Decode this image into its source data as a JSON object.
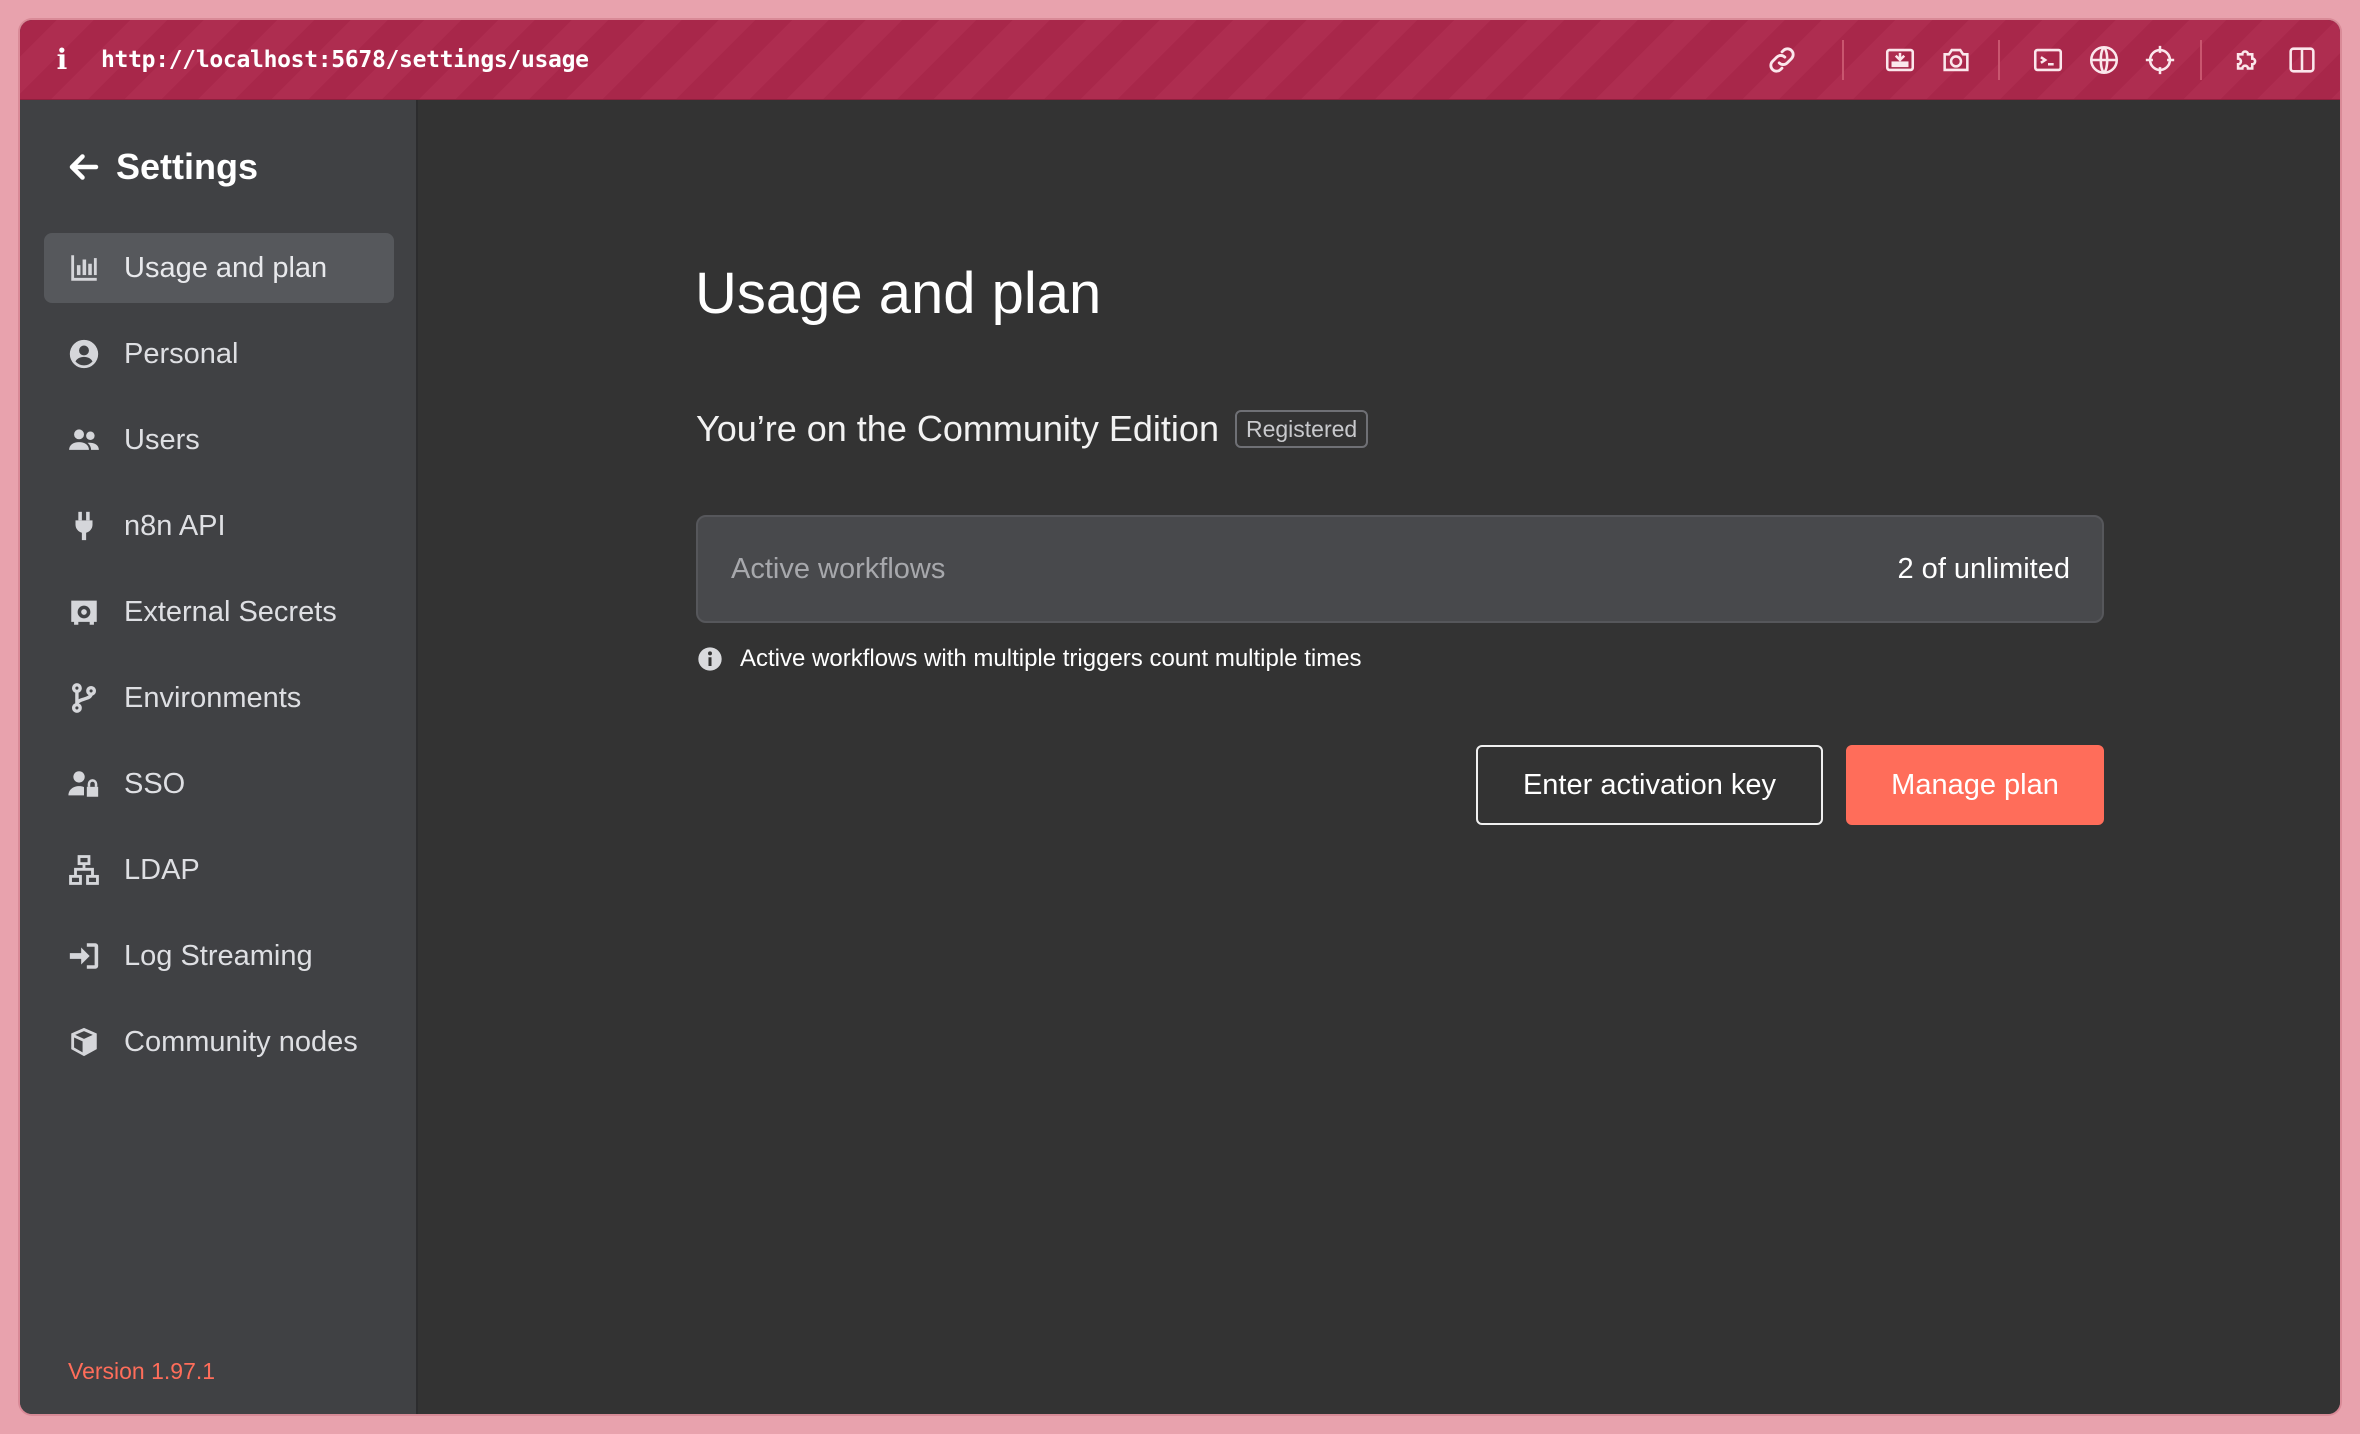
{
  "browser": {
    "url": "http://localhost:5678/settings/usage",
    "info_glyph": "i",
    "icons": [
      "link-icon",
      "screenshot-area-icon",
      "camera-icon",
      "terminal-icon",
      "globe-icon",
      "crosshair-icon",
      "extensions-icon",
      "sidebar-toggle-icon"
    ]
  },
  "sidebar": {
    "title": "Settings",
    "items": [
      {
        "label": "Usage and plan",
        "icon": "chart-bar-icon",
        "active": true
      },
      {
        "label": "Personal",
        "icon": "user-circle-icon",
        "active": false
      },
      {
        "label": "Users",
        "icon": "users-icon",
        "active": false
      },
      {
        "label": "n8n API",
        "icon": "plug-icon",
        "active": false
      },
      {
        "label": "External Secrets",
        "icon": "vault-icon",
        "active": false
      },
      {
        "label": "Environments",
        "icon": "code-branch-icon",
        "active": false
      },
      {
        "label": "SSO",
        "icon": "user-lock-icon",
        "active": false
      },
      {
        "label": "LDAP",
        "icon": "network-icon",
        "active": false
      },
      {
        "label": "Log Streaming",
        "icon": "sign-in-icon",
        "active": false
      },
      {
        "label": "Community nodes",
        "icon": "cube-icon",
        "active": false
      }
    ],
    "version": "Version 1.97.1"
  },
  "main": {
    "title": "Usage and plan",
    "edition": "You’re on the Community Edition",
    "badge": "Registered",
    "usage": {
      "label": "Active workflows",
      "value": "2 of unlimited"
    },
    "note": "Active workflows with multiple triggers count multiple times",
    "buttons": {
      "activation": "Enter activation key",
      "manage": "Manage plan"
    }
  },
  "colors": {
    "accent": "#ff6d5a",
    "topbar": "#a8274a",
    "sidebar": "#404144",
    "main_bg": "#333333"
  }
}
